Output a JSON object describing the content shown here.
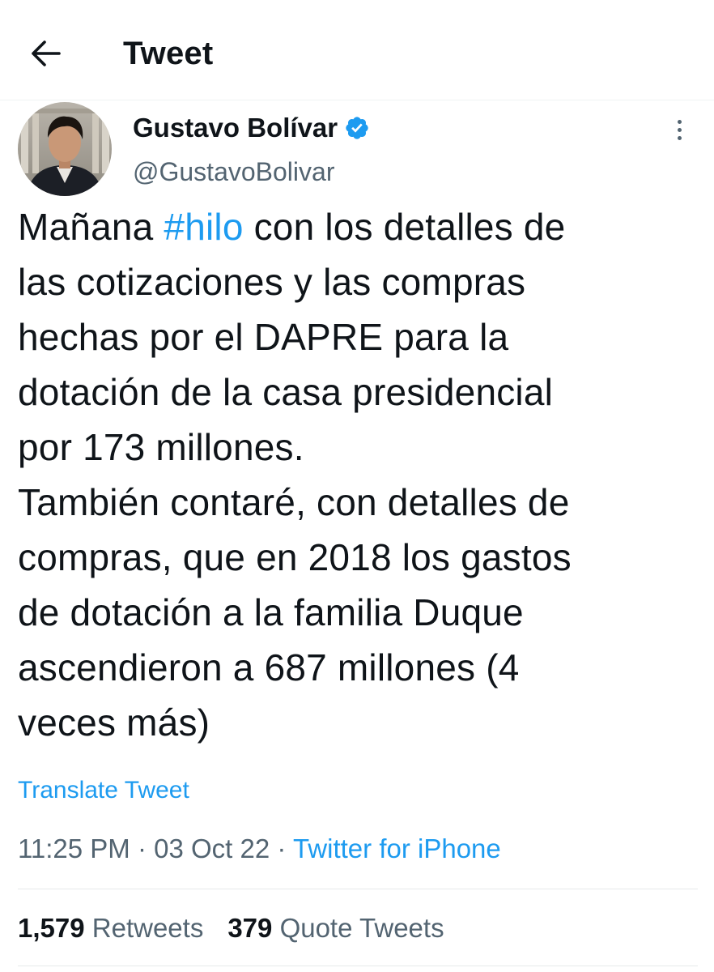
{
  "header": {
    "title": "Tweet",
    "back_icon": "arrow-left-icon"
  },
  "author": {
    "name": "Gustavo Bolívar",
    "handle": "@GustavoBolivar",
    "verified_icon": "verified-badge-icon",
    "more_icon": "more-vertical-icon"
  },
  "tweet": {
    "lines": [
      {
        "before": "Mañana ",
        "hashtag": "#hilo",
        "after": " con los detalles de"
      },
      {
        "text": "las cotizaciones y las compras"
      },
      {
        "text": "hechas por el DAPRE para la"
      },
      {
        "text": "dotación de la casa presidencial"
      },
      {
        "text": "por 173 millones."
      },
      {
        "text": "También contaré, con detalles de"
      },
      {
        "text": "compras, que en 2018 los gastos"
      },
      {
        "text": "de dotación a la familia Duque"
      },
      {
        "text": "ascendieron a 687 millones (4"
      },
      {
        "text": "veces más)"
      }
    ],
    "translate_label": "Translate Tweet"
  },
  "meta": {
    "time": "11:25 PM",
    "separator": " · ",
    "date": "03 Oct 22",
    "source": "Twitter for iPhone"
  },
  "stats": {
    "retweets_count": "1,579",
    "retweets_label": "Retweets",
    "quotes_count": "379",
    "quotes_label": "Quote Tweets"
  },
  "colors": {
    "accent": "#1d9bf0",
    "text": "#0f1419",
    "secondary": "#536471"
  }
}
